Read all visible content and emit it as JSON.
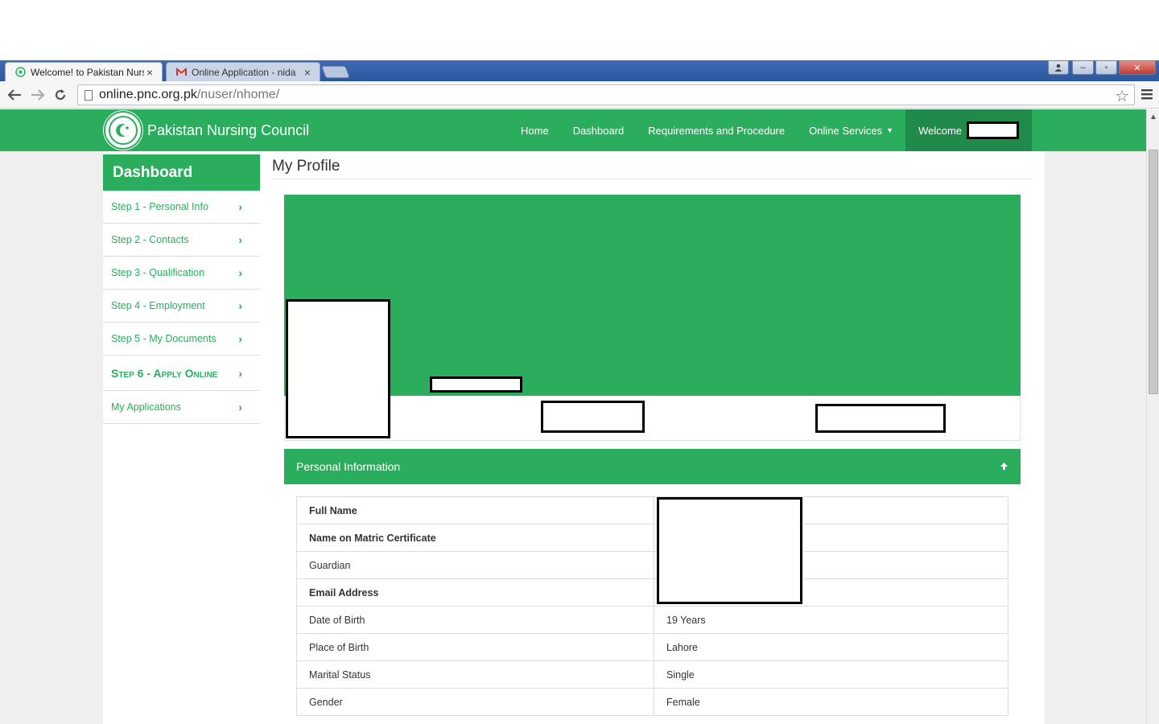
{
  "browser": {
    "tabs": [
      {
        "title": "Welcome! to Pakistan Nursing Council",
        "active": true,
        "icon": "pnc-favicon-icon"
      },
      {
        "title": "Online Application - nida",
        "active": false,
        "icon": "gmail-icon"
      }
    ],
    "close_glyph": "×",
    "url_domain": "online.pnc.org.pk",
    "url_path": "/nuser/nhome/",
    "window_controls": {
      "minimize": "–",
      "maximize": "▫",
      "close": "✕"
    }
  },
  "navbar": {
    "brand": "Pakistan Nursing Council",
    "items": [
      {
        "label": "Home"
      },
      {
        "label": "Dashboard"
      },
      {
        "label": "Requirements and Procedure"
      },
      {
        "label": "Online Services",
        "dropdown": true
      }
    ],
    "welcome_label": "Welcome",
    "caret": "▼"
  },
  "sidebar": {
    "heading": "Dashboard",
    "chevron": "›",
    "items": [
      {
        "label": "Step 1 - Personal Info"
      },
      {
        "label": "Step 2 - Contacts"
      },
      {
        "label": "Step 3 - Qualification"
      },
      {
        "label": "Step 4 - Employment"
      },
      {
        "label": "Step 5 - My Documents"
      },
      {
        "label": "Step 6 - Apply Online",
        "emphasis": true
      },
      {
        "label": "My Applications"
      }
    ]
  },
  "main": {
    "title": "My Profile",
    "panel_title": "Personal Information",
    "panel_toggle_icon": "arrow-up-icon",
    "rows": [
      {
        "label": "Full Name",
        "value": "",
        "bold": true
      },
      {
        "label": "Name on Matric Certificate",
        "value": "",
        "bold": true
      },
      {
        "label": "Guardian",
        "value": "",
        "bold": false
      },
      {
        "label": "Email Address",
        "value": "",
        "bold": true
      },
      {
        "label": "Date of Birth",
        "value": "19 Years",
        "bold": false
      },
      {
        "label": "Place of Birth",
        "value": "Lahore",
        "bold": false
      },
      {
        "label": "Marital Status",
        "value": "Single",
        "bold": false
      },
      {
        "label": "Gender",
        "value": "Female",
        "bold": false
      }
    ]
  },
  "colors": {
    "brand_green": "#2aae5e",
    "brand_green_dark": "#1f8a4a"
  }
}
